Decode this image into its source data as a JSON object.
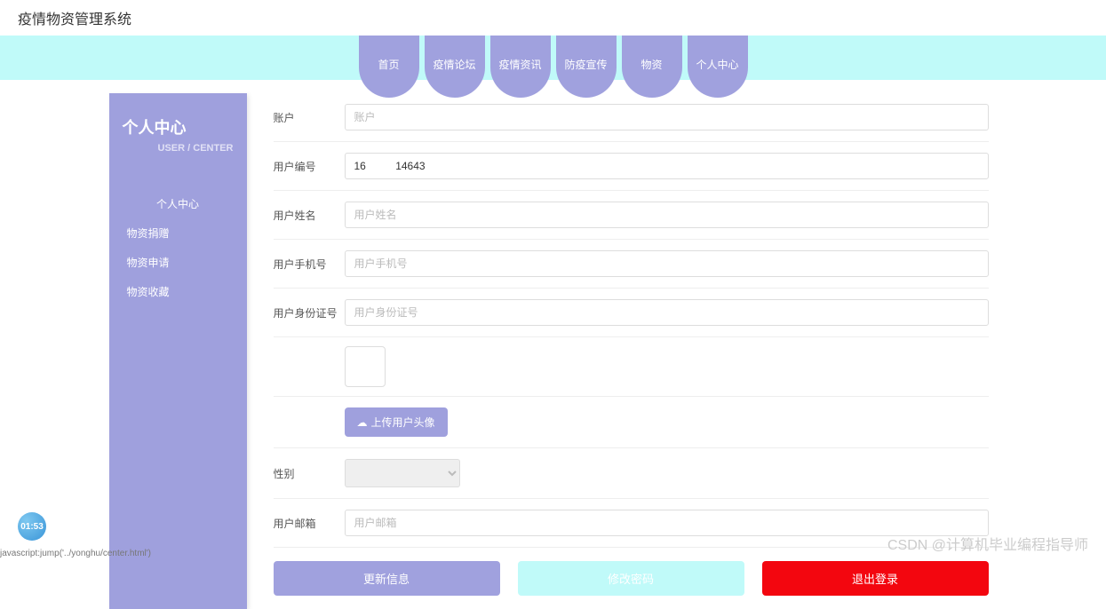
{
  "header": {
    "title": "疫情物资管理系统"
  },
  "nav": {
    "items": [
      {
        "label": "首页"
      },
      {
        "label": "疫情论坛"
      },
      {
        "label": "疫情资讯"
      },
      {
        "label": "防疫宣传"
      },
      {
        "label": "物资"
      },
      {
        "label": "个人中心"
      }
    ]
  },
  "sidebar": {
    "title": "个人中心",
    "subtitle": "USER / CENTER",
    "items": [
      {
        "label": "个人中心",
        "active": true
      },
      {
        "label": "物资捐赠"
      },
      {
        "label": "物资申请"
      },
      {
        "label": "物资收藏"
      }
    ]
  },
  "form": {
    "account": {
      "label": "账户",
      "placeholder": "账户",
      "value": ""
    },
    "userNo": {
      "label": "用户编号",
      "placeholder": "用户编号",
      "value": "16          14643"
    },
    "userName": {
      "label": "用户姓名",
      "placeholder": "用户姓名",
      "value": ""
    },
    "userPhone": {
      "label": "用户手机号",
      "placeholder": "用户手机号",
      "value": ""
    },
    "userId": {
      "label": "用户身份证号",
      "placeholder": "用户身份证号",
      "value": ""
    },
    "uploadAvatar": "上传用户头像",
    "gender": {
      "label": "性别",
      "value": ""
    },
    "userEmail": {
      "label": "用户邮箱",
      "placeholder": "用户邮箱",
      "value": ""
    }
  },
  "buttons": {
    "update": "更新信息",
    "changePwd": "修改密码",
    "logout": "退出登录"
  },
  "timeBadge": "01:53",
  "watermark": "CSDN @计算机毕业编程指导师",
  "statusBar": "javascript:jump('../yonghu/center.html')"
}
